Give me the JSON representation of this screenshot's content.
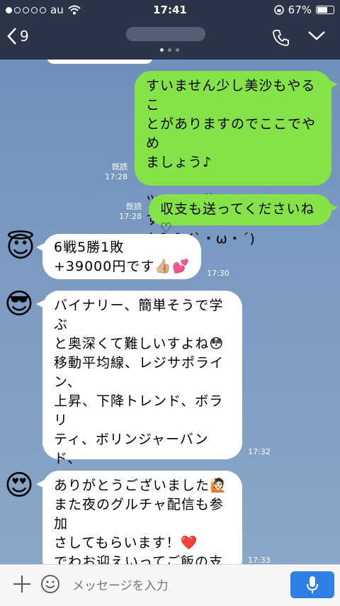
{
  "status_bar": {
    "carrier": "au",
    "time": "17:41",
    "battery": "67%",
    "battery_level": 0.67,
    "signal_dots": 5,
    "signal_filled": 1
  },
  "header": {
    "back_count": "9"
  },
  "messages": [
    {
      "side": "right",
      "text": "すいません少し美沙もやるこ\nとがありますのでここでやめ\nましょう♪\n\nツールは使いだしてどうです\nか？？(`・ω・´)",
      "read": "既読",
      "time": "17:28"
    },
    {
      "side": "right",
      "text": "収支も送ってくださいね♡",
      "read": "既読",
      "time": "17:28"
    },
    {
      "side": "left",
      "avatar": "😇",
      "text": "6戦5勝1敗\n+39000円です👍🏼💕",
      "time": "17:30"
    },
    {
      "side": "left",
      "avatar": "😎",
      "text": "バイナリー、簡単そうで学ぶ\nと奥深くて難しいすよね😳\n移動平均線、レジサポライン、\n上昇、下降トレンド、ボラリ\nティ、ボリンジャーバンド、\nストキャスティクス、\n色んなことを考えて一つの取\n引を行うので奥深いす🤔 ❤️",
      "time": "17:32"
    },
    {
      "side": "left",
      "avatar": "😍",
      "text": "ありがとうございました🙋🏻\nまた夜のグルチャ配信も参加\nさしてもらいます！❤️\nでわお迎えいってご飯の支度\nしますので失礼します！😭",
      "time": "17:33"
    }
  ],
  "input_bar": {
    "placeholder": "メッセージを入力"
  },
  "colors": {
    "header_bg": "#2b3547",
    "bubble_green": "#85e249",
    "bubble_white": "#ffffff",
    "mic_blue": "#2e7fe4"
  }
}
